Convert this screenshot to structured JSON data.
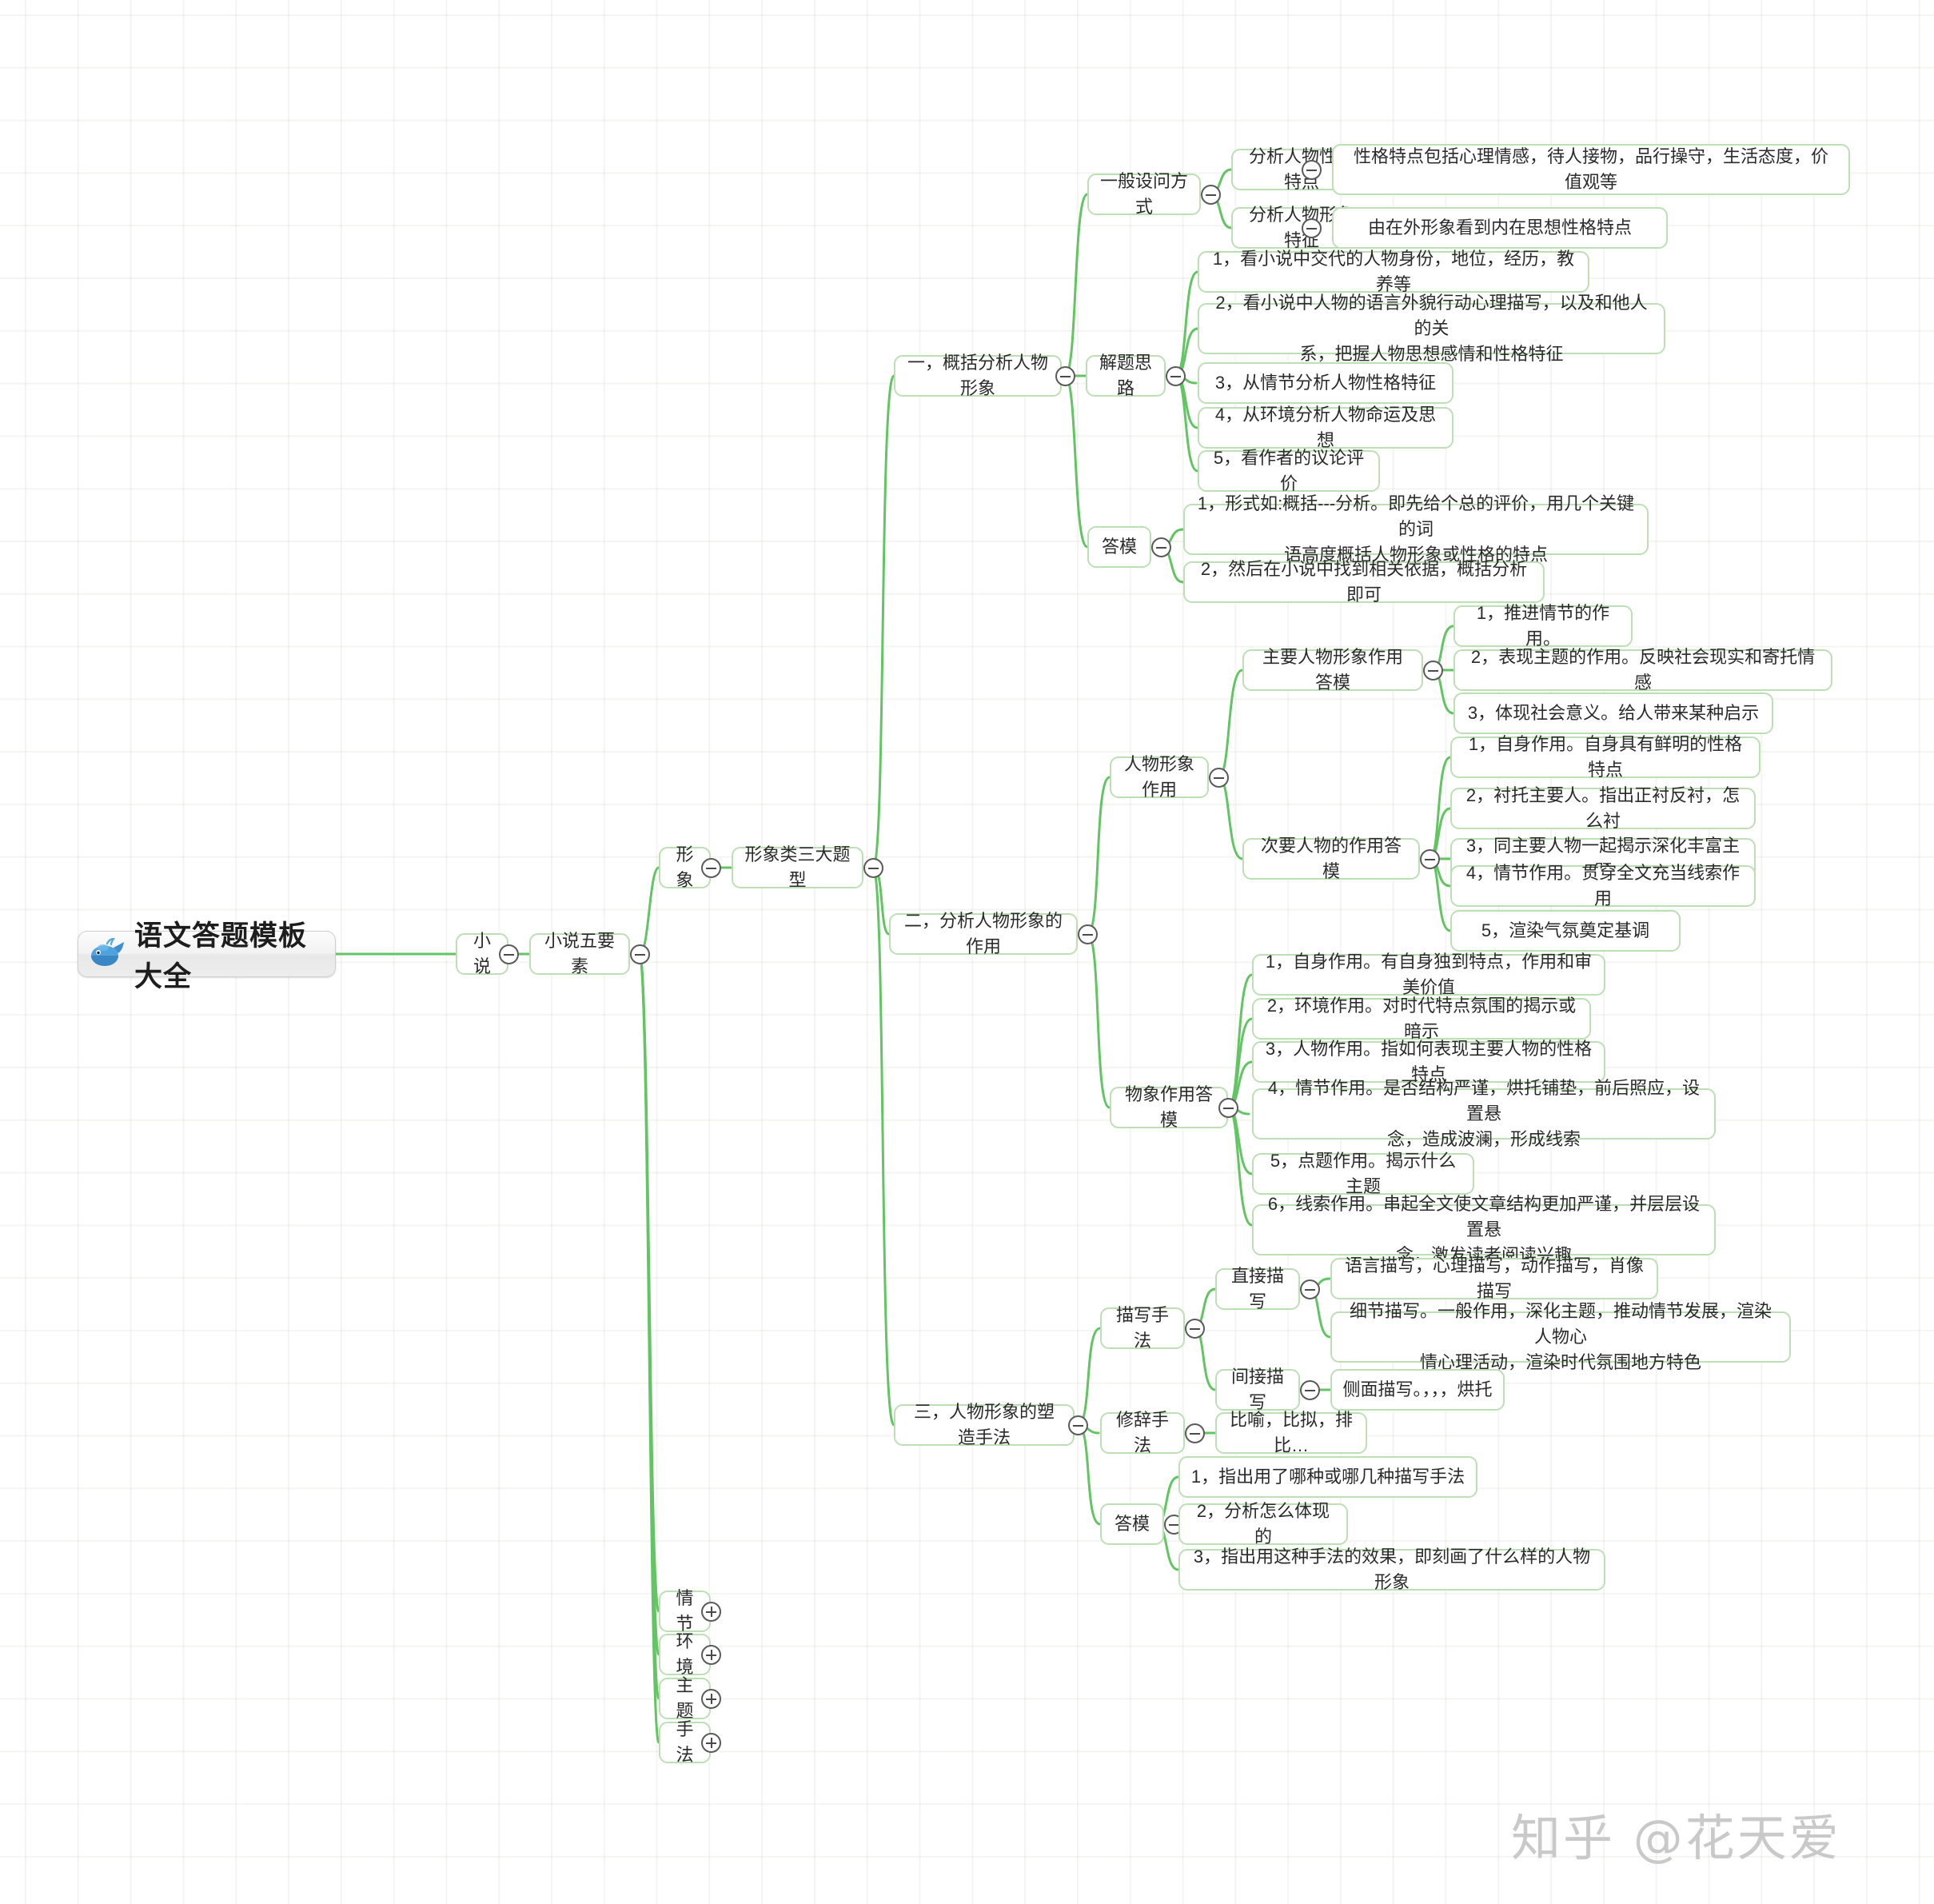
{
  "meta": {
    "watermark": "知乎 @花天爱",
    "accent_color": "#62c462",
    "node_border_color": "#bcdfb4",
    "background_color": "#ffffff"
  },
  "root": {
    "label": "语文答题模板大全",
    "icon": "whale-icon"
  },
  "nodes": {
    "xiaoshuo": "小说",
    "wuyaosu": "小说五要素",
    "xingxiang": "形象",
    "santidaxing": "形象类三大题型",
    "qingjie": "情节",
    "huanjing": "环境",
    "zhuti": "主题",
    "shoufa": "手法",
    "branch1": "一，概括分析人物形象",
    "branch2": "二，分析人物形象的作用",
    "branch3": "三，人物形象的塑造手法",
    "b1_shewen": "一般设问方式",
    "b1_shewen_1": "分析人物性格特点",
    "b1_shewen_1_a": "性格特点包括心理情感，待人接物，品行操守，生活态度，价\n值观等",
    "b1_shewen_2": "分析人物形象特征",
    "b1_shewen_2_a": "由在外形象看到内在思想性格特点",
    "b1_jieti": "解题思路",
    "b1_jieti_1": "1，看小说中交代的人物身份，地位，经历，教养等",
    "b1_jieti_2": "2，看小说中人物的语言外貌行动心理描写，以及和他人的关\n系，把握人物思想感情和性格特征",
    "b1_jieti_3": "3，从情节分析人物性格特征",
    "b1_jieti_4": "4，从环境分析人物命运及思想",
    "b1_jieti_5": "5，看作者的议论评价",
    "b1_damo": "答模",
    "b1_damo_1": "1，形式如:概括---分析。即先给个总的评价，用几个关键的词\n语高度概括人物形象或性格的特点",
    "b1_damo_2": "2，然后在小说中找到相关依据，概括分析即可",
    "b2_renwu": "人物形象作用",
    "b2_zhuyao": "主要人物形象作用答模",
    "b2_zhuyao_1": "1，推进情节的作用。",
    "b2_zhuyao_2": "2，表现主题的作用。反映社会现实和寄托情感",
    "b2_zhuyao_3": "3，体现社会意义。给人带来某种启示",
    "b2_ciyao": "次要人物的作用答模",
    "b2_ciyao_1": "1，自身作用。自身具有鲜明的性格特点",
    "b2_ciyao_2": "2，衬托主要人。指出正衬反衬，怎么衬",
    "b2_ciyao_3": "3，同主要人物一起揭示深化丰富主题",
    "b2_ciyao_4": "4，情节作用。贯穿全文充当线索作用",
    "b2_ciyao_5": "5，渲染气氛奠定基调",
    "b2_wuxiang": "物象作用答模",
    "b2_wuxiang_1": "1，自身作用。有自身独到特点，作用和审美价值",
    "b2_wuxiang_2": "2，环境作用。对时代特点氛围的揭示或暗示",
    "b2_wuxiang_3": "3，人物作用。指如何表现主要人物的性格特点",
    "b2_wuxiang_4": "4，情节作用。是否结构严谨，烘托铺垫，前后照应，设置悬\n念，造成波澜，形成线索",
    "b2_wuxiang_5": "5，点题作用。揭示什么主题",
    "b2_wuxiang_6": "6，线索作用。串起全文使文章结构更加严谨，并层层设置悬\n念，激发读者阅读兴趣",
    "b3_miaoxie": "描写手法",
    "b3_zhijie": "直接描写",
    "b3_zhijie_1": "语言描写，心理描写，动作描写，肖像描写",
    "b3_zhijie_2": "细节描写。一般作用，深化主题，推动情节发展，渲染人物心\n情心理活动，渲染时代氛围地方特色",
    "b3_jianjie": "间接描写",
    "b3_jianjie_1": "侧面描写。，，，烘托",
    "b3_xiuci": "修辞手法",
    "b3_xiuci_1": "比喻，比拟，排比…",
    "b3_damo": "答模",
    "b3_damo_1": "1，指出用了哪种或哪几种描写手法",
    "b3_damo_2": "2，分析怎么体现的",
    "b3_damo_3": "3，指出用这种手法的效果，即刻画了什么样的人物形象"
  }
}
